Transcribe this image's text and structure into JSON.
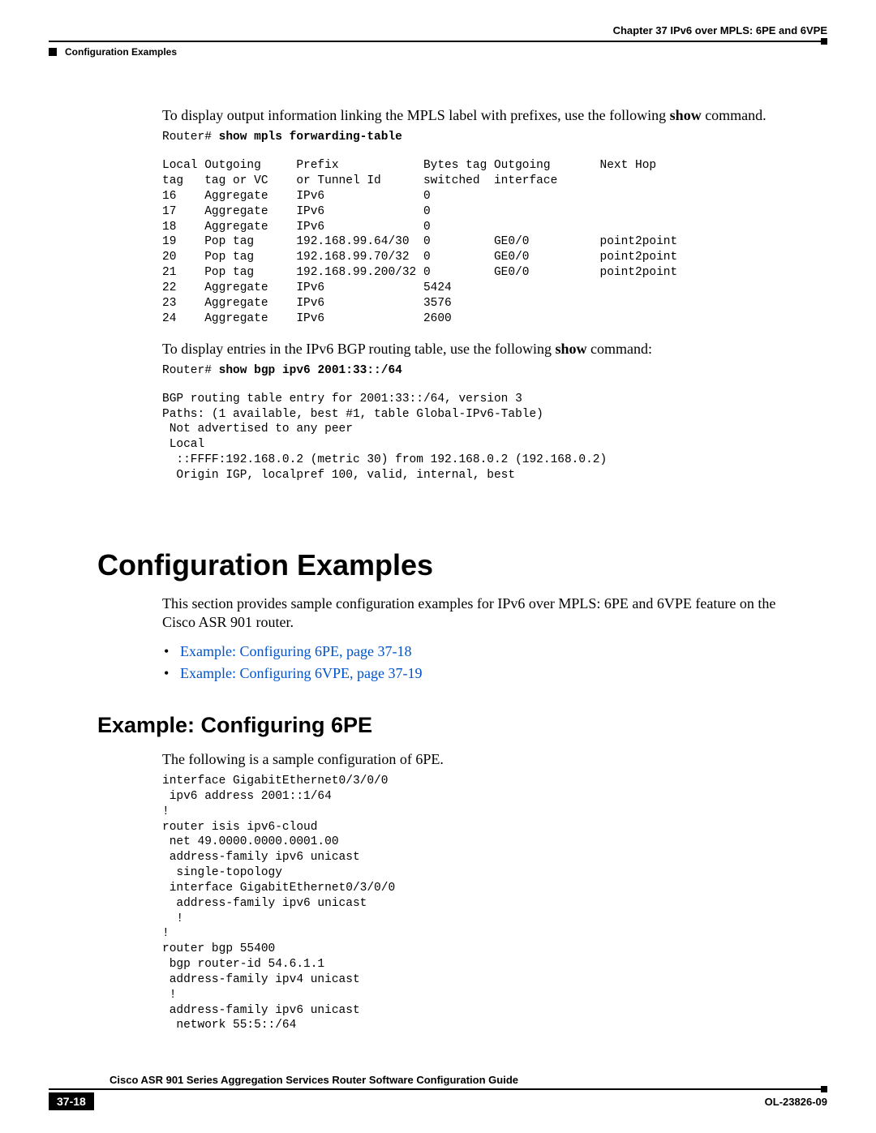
{
  "header": {
    "chapter": "Chapter 37    IPv6 over MPLS: 6PE and 6VPE",
    "section": "Configuration Examples"
  },
  "para1_pre": "To display output information linking the MPLS label with prefixes, use the following ",
  "para1_bold": "show",
  "para1_post": " command.",
  "cmd1_prompt": "Router# ",
  "cmd1_bold": "show mpls forwarding-table",
  "table1": "Local Outgoing     Prefix            Bytes tag Outgoing       Next Hop\ntag   tag or VC    or Tunnel Id      switched  interface\n16    Aggregate    IPv6              0\n17    Aggregate    IPv6              0\n18    Aggregate    IPv6              0\n19    Pop tag      192.168.99.64/30  0         GE0/0          point2point\n20    Pop tag      192.168.99.70/32  0         GE0/0          point2point\n21    Pop tag      192.168.99.200/32 0         GE0/0          point2point\n22    Aggregate    IPv6              5424\n23    Aggregate    IPv6              3576\n24    Aggregate    IPv6              2600",
  "para2_pre": "To display entries in the IPv6 BGP routing table, use the following ",
  "para2_bold": "show",
  "para2_post": " command:",
  "cmd2_prompt": "Router# ",
  "cmd2_bold": "show bgp ipv6 2001:33::/64",
  "table2": "BGP routing table entry for 2001:33::/64, version 3\nPaths: (1 available, best #1, table Global-IPv6-Table)\n Not advertised to any peer\n Local\n  ::FFFF:192.168.0.2 (metric 30) from 192.168.0.2 (192.168.0.2)\n  Origin IGP, localpref 100, valid, internal, best",
  "h1": "Configuration Examples",
  "para3": "This section provides sample configuration examples for IPv6 over MPLS: 6PE and 6VPE feature on the Cisco ASR 901 router.",
  "links": [
    "Example: Configuring 6PE, page 37-18",
    "Example: Configuring 6VPE, page 37-19"
  ],
  "h2": "Example: Configuring 6PE",
  "para4": "The following is a sample configuration of 6PE.",
  "config": "interface GigabitEthernet0/3/0/0\n ipv6 address 2001::1/64\n!\nrouter isis ipv6-cloud\n net 49.0000.0000.0001.00\n address-family ipv6 unicast\n  single-topology\n interface GigabitEthernet0/3/0/0\n  address-family ipv6 unicast\n  !\n!\nrouter bgp 55400\n bgp router-id 54.6.1.1\n address-family ipv4 unicast\n !\n address-family ipv6 unicast\n  network 55:5::/64",
  "footer": {
    "title": "Cisco ASR 901 Series Aggregation Services Router Software Configuration Guide",
    "page": "37-18",
    "docid": "OL-23826-09"
  }
}
